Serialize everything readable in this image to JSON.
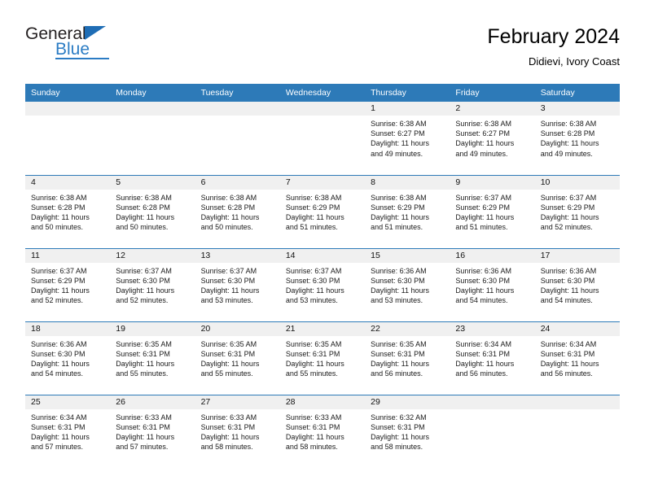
{
  "brand": {
    "name_part1": "General",
    "name_part2": "Blue",
    "triangle_icon": "triangle-icon",
    "accent_color": "#2b7cc4"
  },
  "header": {
    "title": "February 2024",
    "subtitle": "Didievi, Ivory Coast"
  },
  "calendar": {
    "header_bg": "#2d7ab8",
    "daynum_bg": "#f0f0f0",
    "weekday_headers": [
      "Sunday",
      "Monday",
      "Tuesday",
      "Wednesday",
      "Thursday",
      "Friday",
      "Saturday"
    ],
    "weeks": [
      [
        {
          "day": "",
          "sunrise": "",
          "sunset": "",
          "daylight_line1": "",
          "daylight_line2": ""
        },
        {
          "day": "",
          "sunrise": "",
          "sunset": "",
          "daylight_line1": "",
          "daylight_line2": ""
        },
        {
          "day": "",
          "sunrise": "",
          "sunset": "",
          "daylight_line1": "",
          "daylight_line2": ""
        },
        {
          "day": "",
          "sunrise": "",
          "sunset": "",
          "daylight_line1": "",
          "daylight_line2": ""
        },
        {
          "day": "1",
          "sunrise": "Sunrise: 6:38 AM",
          "sunset": "Sunset: 6:27 PM",
          "daylight_line1": "Daylight: 11 hours",
          "daylight_line2": "and 49 minutes."
        },
        {
          "day": "2",
          "sunrise": "Sunrise: 6:38 AM",
          "sunset": "Sunset: 6:27 PM",
          "daylight_line1": "Daylight: 11 hours",
          "daylight_line2": "and 49 minutes."
        },
        {
          "day": "3",
          "sunrise": "Sunrise: 6:38 AM",
          "sunset": "Sunset: 6:28 PM",
          "daylight_line1": "Daylight: 11 hours",
          "daylight_line2": "and 49 minutes."
        }
      ],
      [
        {
          "day": "4",
          "sunrise": "Sunrise: 6:38 AM",
          "sunset": "Sunset: 6:28 PM",
          "daylight_line1": "Daylight: 11 hours",
          "daylight_line2": "and 50 minutes."
        },
        {
          "day": "5",
          "sunrise": "Sunrise: 6:38 AM",
          "sunset": "Sunset: 6:28 PM",
          "daylight_line1": "Daylight: 11 hours",
          "daylight_line2": "and 50 minutes."
        },
        {
          "day": "6",
          "sunrise": "Sunrise: 6:38 AM",
          "sunset": "Sunset: 6:28 PM",
          "daylight_line1": "Daylight: 11 hours",
          "daylight_line2": "and 50 minutes."
        },
        {
          "day": "7",
          "sunrise": "Sunrise: 6:38 AM",
          "sunset": "Sunset: 6:29 PM",
          "daylight_line1": "Daylight: 11 hours",
          "daylight_line2": "and 51 minutes."
        },
        {
          "day": "8",
          "sunrise": "Sunrise: 6:38 AM",
          "sunset": "Sunset: 6:29 PM",
          "daylight_line1": "Daylight: 11 hours",
          "daylight_line2": "and 51 minutes."
        },
        {
          "day": "9",
          "sunrise": "Sunrise: 6:37 AM",
          "sunset": "Sunset: 6:29 PM",
          "daylight_line1": "Daylight: 11 hours",
          "daylight_line2": "and 51 minutes."
        },
        {
          "day": "10",
          "sunrise": "Sunrise: 6:37 AM",
          "sunset": "Sunset: 6:29 PM",
          "daylight_line1": "Daylight: 11 hours",
          "daylight_line2": "and 52 minutes."
        }
      ],
      [
        {
          "day": "11",
          "sunrise": "Sunrise: 6:37 AM",
          "sunset": "Sunset: 6:29 PM",
          "daylight_line1": "Daylight: 11 hours",
          "daylight_line2": "and 52 minutes."
        },
        {
          "day": "12",
          "sunrise": "Sunrise: 6:37 AM",
          "sunset": "Sunset: 6:30 PM",
          "daylight_line1": "Daylight: 11 hours",
          "daylight_line2": "and 52 minutes."
        },
        {
          "day": "13",
          "sunrise": "Sunrise: 6:37 AM",
          "sunset": "Sunset: 6:30 PM",
          "daylight_line1": "Daylight: 11 hours",
          "daylight_line2": "and 53 minutes."
        },
        {
          "day": "14",
          "sunrise": "Sunrise: 6:37 AM",
          "sunset": "Sunset: 6:30 PM",
          "daylight_line1": "Daylight: 11 hours",
          "daylight_line2": "and 53 minutes."
        },
        {
          "day": "15",
          "sunrise": "Sunrise: 6:36 AM",
          "sunset": "Sunset: 6:30 PM",
          "daylight_line1": "Daylight: 11 hours",
          "daylight_line2": "and 53 minutes."
        },
        {
          "day": "16",
          "sunrise": "Sunrise: 6:36 AM",
          "sunset": "Sunset: 6:30 PM",
          "daylight_line1": "Daylight: 11 hours",
          "daylight_line2": "and 54 minutes."
        },
        {
          "day": "17",
          "sunrise": "Sunrise: 6:36 AM",
          "sunset": "Sunset: 6:30 PM",
          "daylight_line1": "Daylight: 11 hours",
          "daylight_line2": "and 54 minutes."
        }
      ],
      [
        {
          "day": "18",
          "sunrise": "Sunrise: 6:36 AM",
          "sunset": "Sunset: 6:30 PM",
          "daylight_line1": "Daylight: 11 hours",
          "daylight_line2": "and 54 minutes."
        },
        {
          "day": "19",
          "sunrise": "Sunrise: 6:35 AM",
          "sunset": "Sunset: 6:31 PM",
          "daylight_line1": "Daylight: 11 hours",
          "daylight_line2": "and 55 minutes."
        },
        {
          "day": "20",
          "sunrise": "Sunrise: 6:35 AM",
          "sunset": "Sunset: 6:31 PM",
          "daylight_line1": "Daylight: 11 hours",
          "daylight_line2": "and 55 minutes."
        },
        {
          "day": "21",
          "sunrise": "Sunrise: 6:35 AM",
          "sunset": "Sunset: 6:31 PM",
          "daylight_line1": "Daylight: 11 hours",
          "daylight_line2": "and 55 minutes."
        },
        {
          "day": "22",
          "sunrise": "Sunrise: 6:35 AM",
          "sunset": "Sunset: 6:31 PM",
          "daylight_line1": "Daylight: 11 hours",
          "daylight_line2": "and 56 minutes."
        },
        {
          "day": "23",
          "sunrise": "Sunrise: 6:34 AM",
          "sunset": "Sunset: 6:31 PM",
          "daylight_line1": "Daylight: 11 hours",
          "daylight_line2": "and 56 minutes."
        },
        {
          "day": "24",
          "sunrise": "Sunrise: 6:34 AM",
          "sunset": "Sunset: 6:31 PM",
          "daylight_line1": "Daylight: 11 hours",
          "daylight_line2": "and 56 minutes."
        }
      ],
      [
        {
          "day": "25",
          "sunrise": "Sunrise: 6:34 AM",
          "sunset": "Sunset: 6:31 PM",
          "daylight_line1": "Daylight: 11 hours",
          "daylight_line2": "and 57 minutes."
        },
        {
          "day": "26",
          "sunrise": "Sunrise: 6:33 AM",
          "sunset": "Sunset: 6:31 PM",
          "daylight_line1": "Daylight: 11 hours",
          "daylight_line2": "and 57 minutes."
        },
        {
          "day": "27",
          "sunrise": "Sunrise: 6:33 AM",
          "sunset": "Sunset: 6:31 PM",
          "daylight_line1": "Daylight: 11 hours",
          "daylight_line2": "and 58 minutes."
        },
        {
          "day": "28",
          "sunrise": "Sunrise: 6:33 AM",
          "sunset": "Sunset: 6:31 PM",
          "daylight_line1": "Daylight: 11 hours",
          "daylight_line2": "and 58 minutes."
        },
        {
          "day": "29",
          "sunrise": "Sunrise: 6:32 AM",
          "sunset": "Sunset: 6:31 PM",
          "daylight_line1": "Daylight: 11 hours",
          "daylight_line2": "and 58 minutes."
        },
        {
          "day": "",
          "sunrise": "",
          "sunset": "",
          "daylight_line1": "",
          "daylight_line2": ""
        },
        {
          "day": "",
          "sunrise": "",
          "sunset": "",
          "daylight_line1": "",
          "daylight_line2": ""
        }
      ]
    ]
  }
}
